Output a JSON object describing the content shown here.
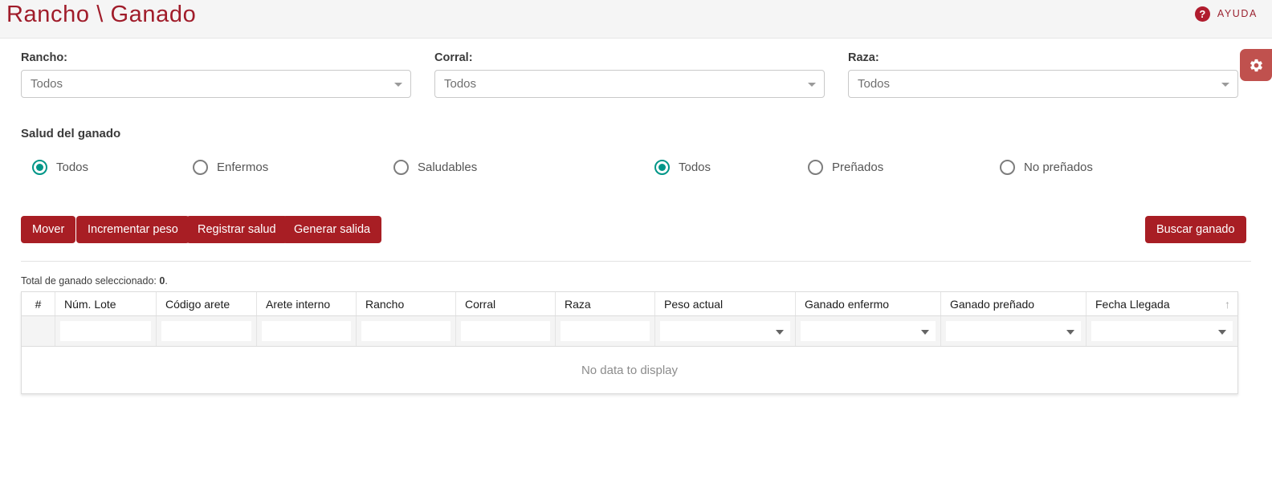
{
  "header": {
    "title": "Rancho \\ Ganado",
    "help_label": "AYUDA",
    "help_icon": "question-mark-circle-icon"
  },
  "filters": {
    "rancho": {
      "label": "Rancho:",
      "value": "Todos"
    },
    "corral": {
      "label": "Corral:",
      "value": "Todos"
    },
    "raza": {
      "label": "Raza:",
      "value": "Todos"
    },
    "settings_icon": "gear-icon"
  },
  "health": {
    "title": "Salud del ganado",
    "options": [
      {
        "label": "Todos",
        "selected": true
      },
      {
        "label": "Enfermos",
        "selected": false
      },
      {
        "label": "Saludables",
        "selected": false
      },
      {
        "label": "Todos",
        "selected": true
      },
      {
        "label": "Preñados",
        "selected": false
      },
      {
        "label": "No preñados",
        "selected": false
      }
    ]
  },
  "actions": {
    "mover": "Mover",
    "incrementar_peso": "Incrementar peso",
    "registrar_salud": "Registrar salud",
    "generar_salida": "Generar salida",
    "buscar_ganado": "Buscar ganado"
  },
  "table": {
    "total_prefix": "Total de ganado seleccionado: ",
    "total_value": "0",
    "total_suffix": ".",
    "columns": [
      {
        "label": "#",
        "filter": "none"
      },
      {
        "label": "Núm. Lote",
        "filter": "text"
      },
      {
        "label": "Código arete",
        "filter": "text"
      },
      {
        "label": "Arete interno",
        "filter": "text"
      },
      {
        "label": "Rancho",
        "filter": "text"
      },
      {
        "label": "Corral",
        "filter": "text"
      },
      {
        "label": "Raza",
        "filter": "text"
      },
      {
        "label": "Peso actual",
        "filter": "select"
      },
      {
        "label": "Ganado enfermo",
        "filter": "select"
      },
      {
        "label": "Ganado preñado",
        "filter": "select"
      },
      {
        "label": "Fecha Llegada",
        "filter": "select",
        "sort": "↑"
      }
    ],
    "rows": [],
    "empty_message": "No data to display"
  },
  "colors": {
    "brand_red": "#a81e24",
    "title_red": "#a01c2a",
    "gear_red": "#c0514e",
    "radio_teal": "#009688"
  }
}
